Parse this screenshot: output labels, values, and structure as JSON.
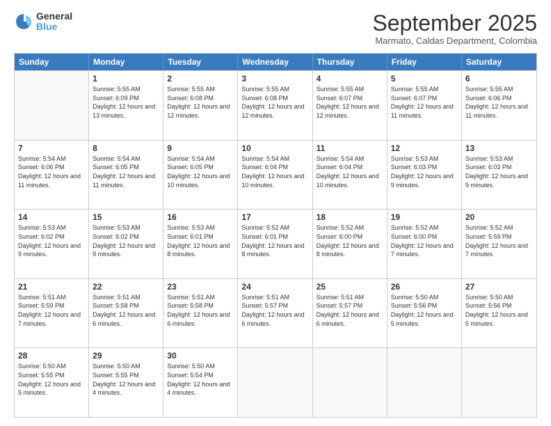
{
  "logo": {
    "line1": "General",
    "line2": "Blue"
  },
  "title": "September 2025",
  "subtitle": "Marmato, Caldas Department, Colombia",
  "days": [
    "Sunday",
    "Monday",
    "Tuesday",
    "Wednesday",
    "Thursday",
    "Friday",
    "Saturday"
  ],
  "weeks": [
    [
      {
        "day": "",
        "empty": true
      },
      {
        "day": "1",
        "sunrise": "Sunrise: 5:55 AM",
        "sunset": "Sunset: 6:09 PM",
        "daylight": "Daylight: 12 hours and 13 minutes."
      },
      {
        "day": "2",
        "sunrise": "Sunrise: 5:55 AM",
        "sunset": "Sunset: 6:08 PM",
        "daylight": "Daylight: 12 hours and 12 minutes."
      },
      {
        "day": "3",
        "sunrise": "Sunrise: 5:55 AM",
        "sunset": "Sunset: 6:08 PM",
        "daylight": "Daylight: 12 hours and 12 minutes."
      },
      {
        "day": "4",
        "sunrise": "Sunrise: 5:55 AM",
        "sunset": "Sunset: 6:07 PM",
        "daylight": "Daylight: 12 hours and 12 minutes."
      },
      {
        "day": "5",
        "sunrise": "Sunrise: 5:55 AM",
        "sunset": "Sunset: 6:07 PM",
        "daylight": "Daylight: 12 hours and 11 minutes."
      },
      {
        "day": "6",
        "sunrise": "Sunrise: 5:55 AM",
        "sunset": "Sunset: 6:06 PM",
        "daylight": "Daylight: 12 hours and 11 minutes."
      }
    ],
    [
      {
        "day": "7",
        "sunrise": "Sunrise: 5:54 AM",
        "sunset": "Sunset: 6:06 PM",
        "daylight": "Daylight: 12 hours and 11 minutes."
      },
      {
        "day": "8",
        "sunrise": "Sunrise: 5:54 AM",
        "sunset": "Sunset: 6:05 PM",
        "daylight": "Daylight: 12 hours and 11 minutes."
      },
      {
        "day": "9",
        "sunrise": "Sunrise: 5:54 AM",
        "sunset": "Sunset: 6:05 PM",
        "daylight": "Daylight: 12 hours and 10 minutes."
      },
      {
        "day": "10",
        "sunrise": "Sunrise: 5:54 AM",
        "sunset": "Sunset: 6:04 PM",
        "daylight": "Daylight: 12 hours and 10 minutes."
      },
      {
        "day": "11",
        "sunrise": "Sunrise: 5:54 AM",
        "sunset": "Sunset: 6:04 PM",
        "daylight": "Daylight: 12 hours and 10 minutes."
      },
      {
        "day": "12",
        "sunrise": "Sunrise: 5:53 AM",
        "sunset": "Sunset: 6:03 PM",
        "daylight": "Daylight: 12 hours and 9 minutes."
      },
      {
        "day": "13",
        "sunrise": "Sunrise: 5:53 AM",
        "sunset": "Sunset: 6:03 PM",
        "daylight": "Daylight: 12 hours and 9 minutes."
      }
    ],
    [
      {
        "day": "14",
        "sunrise": "Sunrise: 5:53 AM",
        "sunset": "Sunset: 6:02 PM",
        "daylight": "Daylight: 12 hours and 9 minutes."
      },
      {
        "day": "15",
        "sunrise": "Sunrise: 5:53 AM",
        "sunset": "Sunset: 6:02 PM",
        "daylight": "Daylight: 12 hours and 9 minutes."
      },
      {
        "day": "16",
        "sunrise": "Sunrise: 5:53 AM",
        "sunset": "Sunset: 6:01 PM",
        "daylight": "Daylight: 12 hours and 8 minutes."
      },
      {
        "day": "17",
        "sunrise": "Sunrise: 5:52 AM",
        "sunset": "Sunset: 6:01 PM",
        "daylight": "Daylight: 12 hours and 8 minutes."
      },
      {
        "day": "18",
        "sunrise": "Sunrise: 5:52 AM",
        "sunset": "Sunset: 6:00 PM",
        "daylight": "Daylight: 12 hours and 8 minutes."
      },
      {
        "day": "19",
        "sunrise": "Sunrise: 5:52 AM",
        "sunset": "Sunset: 6:00 PM",
        "daylight": "Daylight: 12 hours and 7 minutes."
      },
      {
        "day": "20",
        "sunrise": "Sunrise: 5:52 AM",
        "sunset": "Sunset: 5:59 PM",
        "daylight": "Daylight: 12 hours and 7 minutes."
      }
    ],
    [
      {
        "day": "21",
        "sunrise": "Sunrise: 5:51 AM",
        "sunset": "Sunset: 5:59 PM",
        "daylight": "Daylight: 12 hours and 7 minutes."
      },
      {
        "day": "22",
        "sunrise": "Sunrise: 5:51 AM",
        "sunset": "Sunset: 5:58 PM",
        "daylight": "Daylight: 12 hours and 6 minutes."
      },
      {
        "day": "23",
        "sunrise": "Sunrise: 5:51 AM",
        "sunset": "Sunset: 5:58 PM",
        "daylight": "Daylight: 12 hours and 6 minutes."
      },
      {
        "day": "24",
        "sunrise": "Sunrise: 5:51 AM",
        "sunset": "Sunset: 5:57 PM",
        "daylight": "Daylight: 12 hours and 6 minutes."
      },
      {
        "day": "25",
        "sunrise": "Sunrise: 5:51 AM",
        "sunset": "Sunset: 5:57 PM",
        "daylight": "Daylight: 12 hours and 6 minutes."
      },
      {
        "day": "26",
        "sunrise": "Sunrise: 5:50 AM",
        "sunset": "Sunset: 5:56 PM",
        "daylight": "Daylight: 12 hours and 5 minutes."
      },
      {
        "day": "27",
        "sunrise": "Sunrise: 5:50 AM",
        "sunset": "Sunset: 5:56 PM",
        "daylight": "Daylight: 12 hours and 5 minutes."
      }
    ],
    [
      {
        "day": "28",
        "sunrise": "Sunrise: 5:50 AM",
        "sunset": "Sunset: 5:55 PM",
        "daylight": "Daylight: 12 hours and 5 minutes."
      },
      {
        "day": "29",
        "sunrise": "Sunrise: 5:50 AM",
        "sunset": "Sunset: 5:55 PM",
        "daylight": "Daylight: 12 hours and 4 minutes."
      },
      {
        "day": "30",
        "sunrise": "Sunrise: 5:50 AM",
        "sunset": "Sunset: 5:54 PM",
        "daylight": "Daylight: 12 hours and 4 minutes."
      },
      {
        "day": "",
        "empty": true
      },
      {
        "day": "",
        "empty": true
      },
      {
        "day": "",
        "empty": true
      },
      {
        "day": "",
        "empty": true
      }
    ]
  ]
}
